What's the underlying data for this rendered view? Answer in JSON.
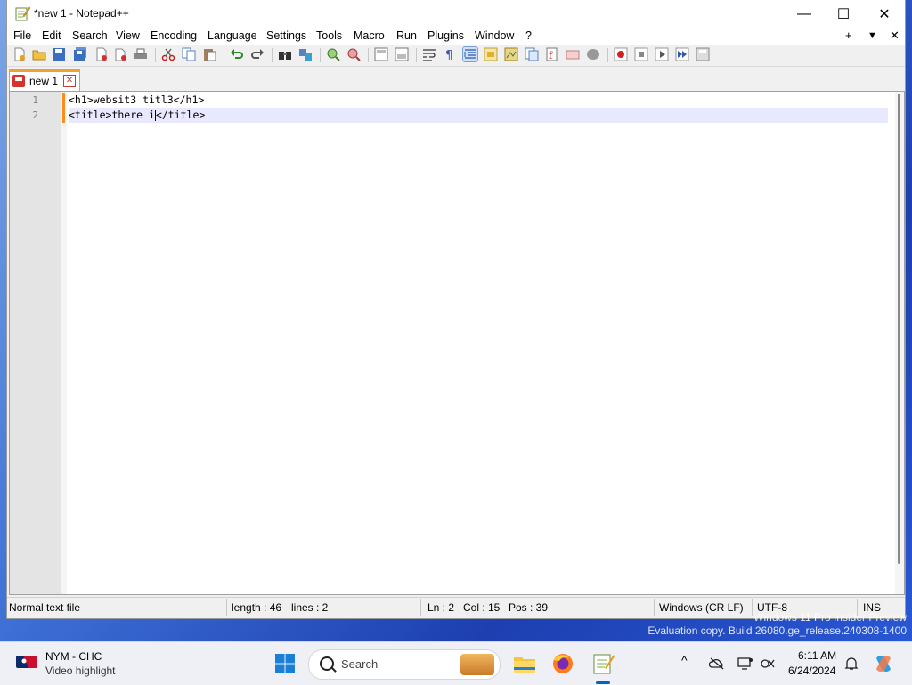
{
  "window": {
    "title": "*new 1 - Notepad++",
    "caption": {
      "minimize": "—",
      "maximize": "☐",
      "close": "✕"
    }
  },
  "menu": {
    "items": [
      "File",
      "Edit",
      "Search",
      "View",
      "Encoding",
      "Language",
      "Settings",
      "Tools",
      "Macro",
      "Run",
      "Plugins",
      "Window",
      "?"
    ],
    "right": {
      "plus": "+",
      "dropdown": "▼",
      "close": "✕"
    }
  },
  "toolbar": {
    "icons": [
      "new-file",
      "open-file",
      "save",
      "save-all",
      "close",
      "close-all",
      "print",
      "cut",
      "copy",
      "paste",
      "undo",
      "redo",
      "find",
      "replace",
      "zoom-in",
      "zoom-out",
      "sync-vertical",
      "sync-horizontal",
      "word-wrap",
      "show-all-chars",
      "indent-guide",
      "user-defined-language",
      "document-map",
      "function-list",
      "folder-as-workspace",
      "document-list",
      "monitoring",
      "record-macro",
      "stop-recording",
      "playback-macro",
      "run-macro-multiple",
      "save-macro"
    ]
  },
  "tab": {
    "label": "new 1",
    "close": "✕"
  },
  "editor": {
    "lines": [
      {
        "number": "1",
        "text": "<h1>websit3 titl3</h1>"
      },
      {
        "number": "2",
        "text_before_caret": "<title>there i",
        "text_after_caret": "</title>"
      }
    ],
    "current_line": 2
  },
  "status": {
    "file_type": "Normal text file",
    "length": "length : 46",
    "lines": "lines : 2",
    "ln": "Ln : 2",
    "col": "Col : 15",
    "pos": "Pos : 39",
    "eol": "Windows (CR LF)",
    "encoding": "UTF-8",
    "mode": "INS"
  },
  "watermark": {
    "line1": "Windows 11 Pro Insider Preview",
    "line2": "Evaluation copy. Build 26080.ge_release.240308-1400"
  },
  "taskbar": {
    "weather_title": "NYM - CHC",
    "weather_sub": "Video highlight",
    "search_label": "Search",
    "time": "6:11 AM",
    "date": "6/24/2024",
    "tray_chevron": "^"
  },
  "colors": {
    "accent": "#0067c0",
    "tab_accent": "#f0a030",
    "current_line": "#e8e8ff",
    "change_marker": "#ff8c1a"
  }
}
